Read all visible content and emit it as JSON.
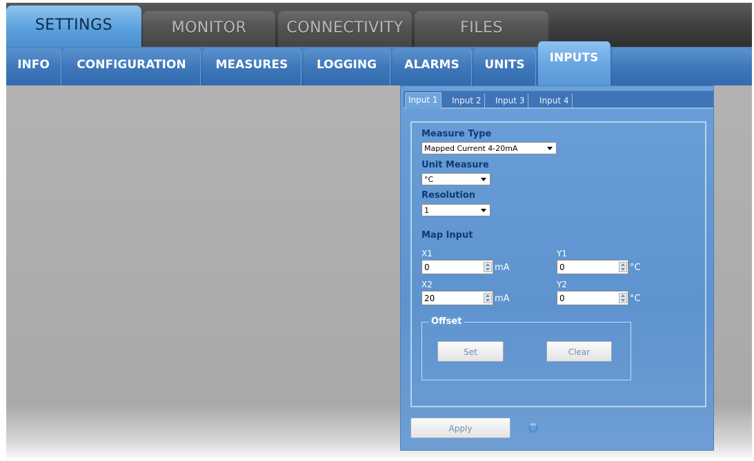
{
  "main_tabs": [
    {
      "label": "SETTINGS"
    },
    {
      "label": "MONITOR"
    },
    {
      "label": "CONNECTIVITY"
    },
    {
      "label": "FILES"
    }
  ],
  "sub_tabs": [
    {
      "label": "INFO"
    },
    {
      "label": "CONFIGURATION"
    },
    {
      "label": "MEASURES"
    },
    {
      "label": "LOGGING"
    },
    {
      "label": "ALARMS"
    },
    {
      "label": "UNITS"
    },
    {
      "label": "INPUTS"
    }
  ],
  "input_tabs": [
    {
      "label": "Input 1"
    },
    {
      "label": "Input 2"
    },
    {
      "label": "Input 3"
    },
    {
      "label": "Input 4"
    }
  ],
  "form": {
    "measure_type_label": "Measure Type",
    "measure_type_value": "Mapped Current 4-20mA",
    "unit_measure_label": "Unit Measure",
    "unit_measure_value": "°C",
    "resolution_label": "Resolution",
    "resolution_value": "1",
    "map_input_label": "Map Input",
    "x1_label": "X1",
    "x1_value": "0",
    "x1_unit": "mA",
    "y1_label": "Y1",
    "y1_value": "0",
    "y1_unit": "°C",
    "x2_label": "X2",
    "x2_value": "20",
    "x2_unit": "mA",
    "y2_label": "Y2",
    "y2_value": "0",
    "y2_unit": "°C",
    "offset_label": "Offset",
    "set_label": "Set",
    "clear_label": "Clear",
    "apply_label": "Apply"
  },
  "colors": {
    "active_tab": "#5aa0dc",
    "panel": "#6a9fd8",
    "header_label": "#0e3a78"
  },
  "icons": {
    "refresh": "refresh-icon"
  }
}
